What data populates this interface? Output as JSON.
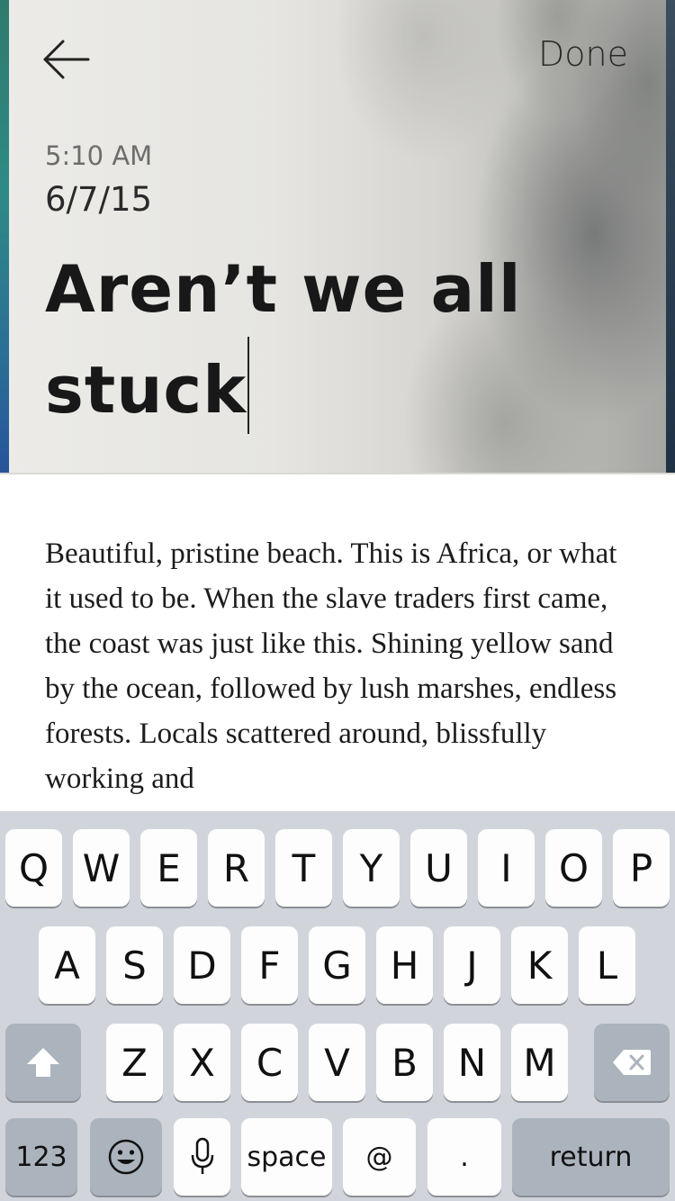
{
  "header": {
    "done_label": "Done",
    "time": "5:10 AM",
    "date": "6/7/15",
    "title": "Aren’t we all stuck"
  },
  "body": {
    "text": "Beautiful, pristine beach. This is Africa, or what it used to be. When the slave traders first came, the coast was just like this. Shining yellow sand by the ocean, followed by lush marshes, endless forests. Locals scattered around, blissfully working and"
  },
  "keyboard": {
    "row1": [
      "Q",
      "W",
      "E",
      "R",
      "T",
      "Y",
      "U",
      "I",
      "O",
      "P"
    ],
    "row2": [
      "A",
      "S",
      "D",
      "F",
      "G",
      "H",
      "J",
      "K",
      "L"
    ],
    "row3": [
      "Z",
      "X",
      "C",
      "V",
      "B",
      "N",
      "M"
    ],
    "numbers_label": "123",
    "space_label": "space",
    "at_label": "@",
    "period_label": ".",
    "return_label": "return"
  },
  "colors": {
    "keyboard_bg": "#d1d5db",
    "key_light": "#fdfdfd",
    "key_dark": "#abb3bd"
  },
  "icons": {
    "back": "arrow-left-icon",
    "shift": "shift-arrow-icon",
    "delete": "backspace-icon",
    "emoji": "smiley-icon",
    "dictation": "microphone-icon"
  }
}
